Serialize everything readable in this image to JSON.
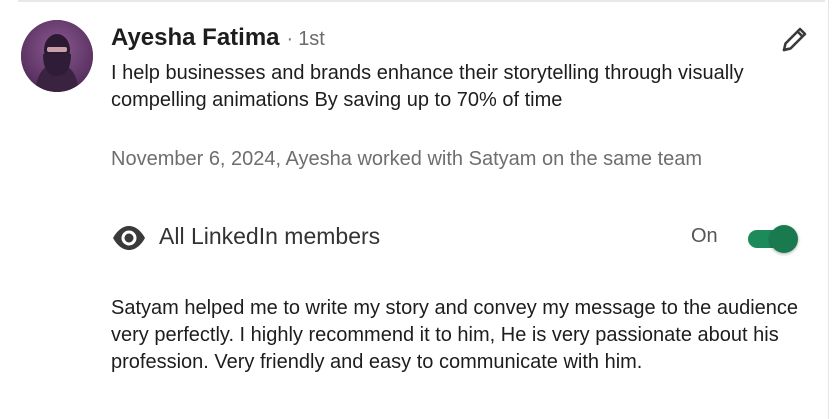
{
  "recommender": {
    "name": "Ayesha Fatima",
    "separator": "·",
    "degree": "1st",
    "headline": "I help businesses and brands enhance their storytelling through visually compelling animations By saving up to 70% of time",
    "meta": "November 6, 2024, Ayesha worked with Satyam on the same team"
  },
  "visibility": {
    "label": "All LinkedIn members",
    "toggle_state_label": "On",
    "enabled": true
  },
  "recommendation_text": "Satyam helped me to write my story and convey my message to the audience very perfectly. I highly recommend it to him, He is very passionate about his profession. Very friendly and easy to communicate with him.",
  "icons": {
    "edit": "pencil-icon",
    "visibility": "eye-icon"
  },
  "colors": {
    "toggle_on": "#1d8a5a",
    "avatar_bg": "#6a3d70"
  }
}
